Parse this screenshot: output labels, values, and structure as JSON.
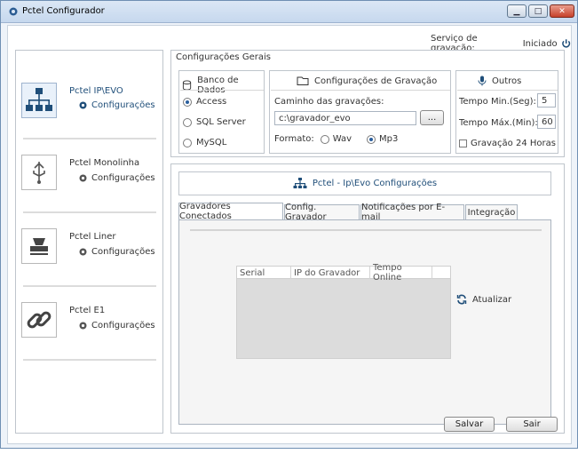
{
  "window": {
    "title": "Pctel Configurador"
  },
  "status": {
    "label": "Serviço de gravação:",
    "value": "Iniciado"
  },
  "sidebar": {
    "items": [
      {
        "name": "Pctel IP\\EVO",
        "config": "Configurações",
        "icon": "network-icon",
        "active": true
      },
      {
        "name": "Pctel Monolinha",
        "config": "Configurações",
        "icon": "usb-icon"
      },
      {
        "name": "Pctel Liner",
        "config": "Configurações",
        "icon": "device-icon"
      },
      {
        "name": "Pctel E1",
        "config": "Configurações",
        "icon": "link-icon"
      }
    ]
  },
  "general": {
    "title": "Configurações Gerais",
    "db": {
      "title": "Banco de Dados",
      "options": [
        "Access",
        "SQL Server",
        "MySQL"
      ],
      "selected": "Access"
    },
    "rec": {
      "title": "Configurações de Gravação",
      "path_label": "Caminho das gravações:",
      "path_value": "c:\\gravador_evo",
      "browse": "...",
      "format_label": "Formato:",
      "formats": [
        "Wav",
        "Mp3"
      ],
      "selected": "Mp3"
    },
    "others": {
      "title": "Outros",
      "min_label": "Tempo Min.(Seg):",
      "min_value": "5",
      "max_label": "Tempo Máx.(Min):",
      "max_value": "60",
      "rec24_label": "Gravação 24 Horas",
      "rec24_checked": false
    }
  },
  "details": {
    "title": "Pctel - Ip\\Evo Configurações",
    "tabs": [
      "Gravadores Conectados",
      "Config. Gravador",
      "Notificações por E-mail",
      "Integração"
    ],
    "active_tab": "Gravadores Conectados",
    "grid": {
      "columns": [
        "Serial",
        "IP do Gravador",
        "Tempo Online"
      ]
    },
    "refresh": "Atualizar"
  },
  "footer": {
    "save": "Salvar",
    "exit": "Sair"
  },
  "colors": {
    "accent": "#1f4e79",
    "title_gradient_top": "#dbe7f5",
    "close_red": "#c6402a"
  }
}
